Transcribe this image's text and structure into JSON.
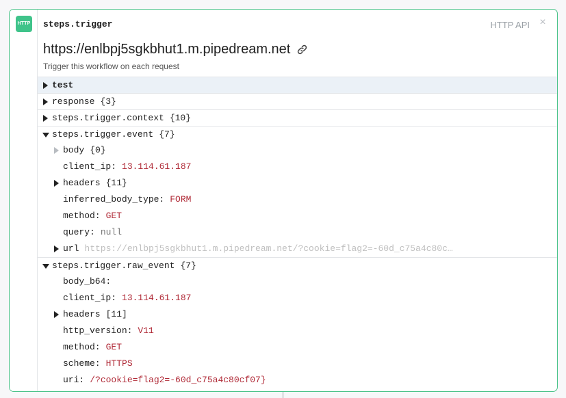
{
  "step": {
    "badge": "HTTP",
    "name": "steps.trigger",
    "type_label": "HTTP API",
    "close_glyph": "×",
    "endpoint_url": "https://enlbpj5sgkbhut1.m.pipedream.net",
    "subtitle": "Trigger this workflow on each request",
    "link_icon": "link-icon"
  },
  "tree": {
    "test": "test",
    "response": {
      "key": "response",
      "count": "{3}"
    },
    "context": {
      "key": "steps.trigger.context",
      "count": "{10}"
    },
    "event": {
      "key": "steps.trigger.event",
      "count": "{7}",
      "body": {
        "key": "body",
        "count": "{0}"
      },
      "client_ip": {
        "key": "client_ip:",
        "value": "13.114.61.187"
      },
      "headers": {
        "key": "headers",
        "count": "{11}"
      },
      "inferred_body_type": {
        "key": "inferred_body_type:",
        "value": "FORM"
      },
      "method": {
        "key": "method:",
        "value": "GET"
      },
      "query": {
        "key": "query:",
        "value": "null"
      },
      "url": {
        "key": "url",
        "value": "https://enlbpj5sgkbhut1.m.pipedream.net/?cookie=flag2=-60d_c75a4c80cf…"
      }
    },
    "raw_event": {
      "key": "steps.trigger.raw_event",
      "count": "{7}",
      "body_b64": {
        "key": "body_b64:"
      },
      "client_ip": {
        "key": "client_ip:",
        "value": "13.114.61.187"
      },
      "headers": {
        "key": "headers",
        "count": "[11]"
      },
      "http_version": {
        "key": "http_version:",
        "value": "V11"
      },
      "method": {
        "key": "method:",
        "value": "GET"
      },
      "scheme": {
        "key": "scheme:",
        "value": "HTTPS"
      },
      "uri": {
        "key": "uri:",
        "value": "/?cookie=flag2=-60d_c75a4c80cf07}"
      }
    }
  },
  "colors": {
    "accent": "#3fc38a",
    "value_red": "#b02a37",
    "muted": "#bfbfbf"
  }
}
